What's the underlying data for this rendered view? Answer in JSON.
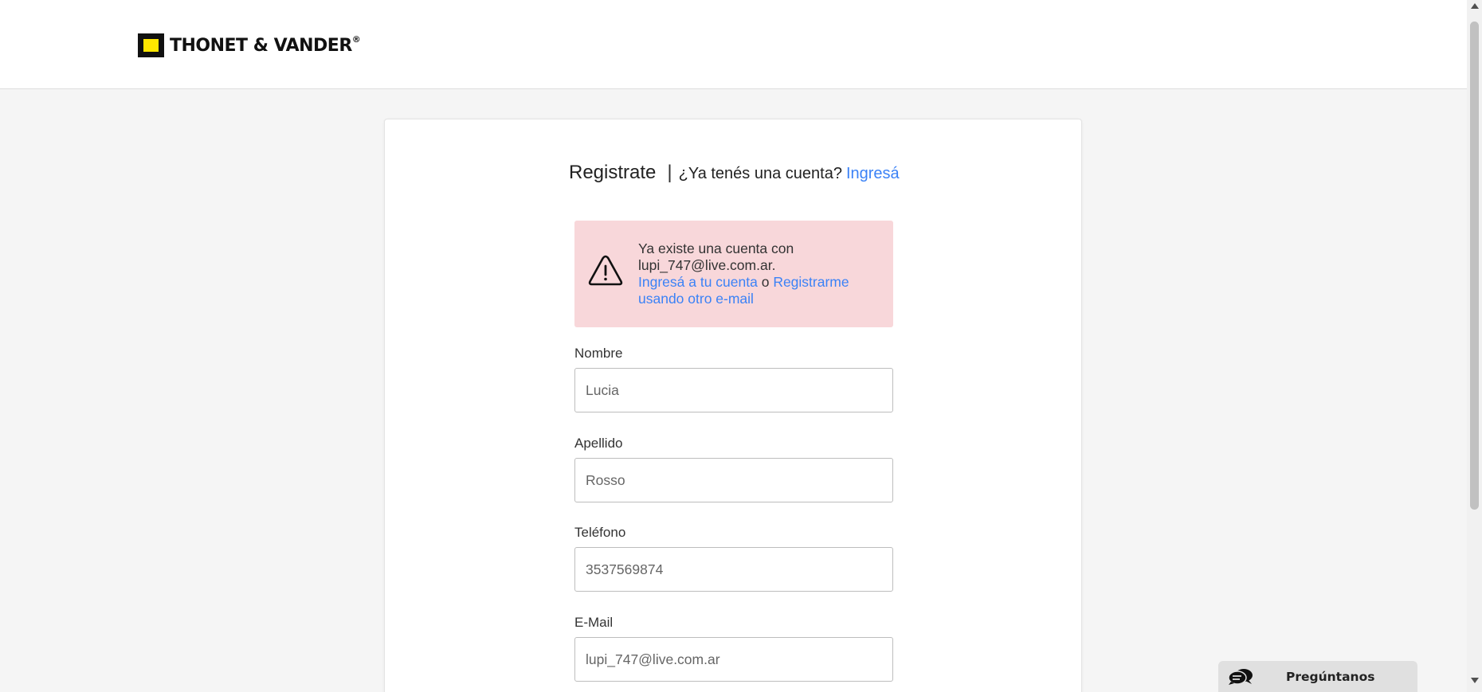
{
  "header": {
    "brand": "THONET & VANDER",
    "brand_mark": "®"
  },
  "form": {
    "title": "Registrate",
    "separator": "|",
    "login_question": "¿Ya tenés una cuenta?",
    "login_link": "Ingresá",
    "alert": {
      "icon": "warning-triangle-icon",
      "message": "Ya existe una cuenta con lupi_747@live.com.ar.",
      "login_link": "Ingresá a tu cuenta",
      "connector": "o",
      "register_other_link": "Registrarme usando otro e-mail"
    },
    "fields": {
      "nombre": {
        "label": "Nombre",
        "value": "Lucia"
      },
      "apellido": {
        "label": "Apellido",
        "value": "Rosso"
      },
      "telefono": {
        "label": "Teléfono",
        "value": "3537569874"
      },
      "email": {
        "label": "E-Mail",
        "value": "lupi_747@live.com.ar"
      }
    }
  },
  "chat": {
    "label": "Pregúntanos",
    "icon": "chat-bubbles-icon"
  },
  "colors": {
    "link": "#3b82f6",
    "alert_bg": "#f8d7da",
    "logo_yellow": "#ffe600"
  }
}
